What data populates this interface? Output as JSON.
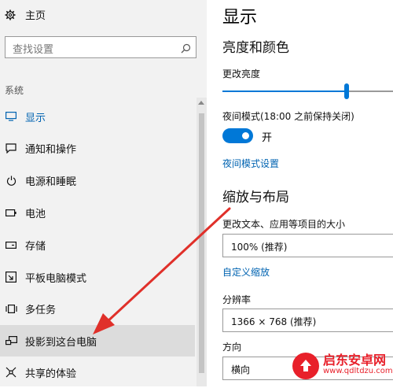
{
  "sidebar": {
    "home_label": "主页",
    "search_placeholder": "查找设置",
    "section_label": "系统",
    "items": [
      {
        "label": "显示",
        "icon": "monitor-icon",
        "active": true
      },
      {
        "label": "通知和操作",
        "icon": "chat-bubble-icon"
      },
      {
        "label": "电源和睡眠",
        "icon": "power-icon"
      },
      {
        "label": "电池",
        "icon": "battery-icon"
      },
      {
        "label": "存储",
        "icon": "storage-icon"
      },
      {
        "label": "平板电脑模式",
        "icon": "tablet-mode-icon"
      },
      {
        "label": "多任务",
        "icon": "multitasking-icon"
      },
      {
        "label": "投影到这台电脑",
        "icon": "project-icon",
        "hover": true
      },
      {
        "label": "共享的体验",
        "icon": "shared-experiences-icon"
      }
    ]
  },
  "main": {
    "title": "显示",
    "brightness_heading": "亮度和颜色",
    "brightness_label": "更改亮度",
    "brightness_value": 0.73,
    "night_mode_label": "夜间模式(18:00 之前保持关闭)",
    "night_mode_state": "开",
    "night_mode_link": "夜间模式设置",
    "scale_heading": "缩放与布局",
    "scale_label": "更改文本、应用等项目的大小",
    "scale_value": "100% (推荐)",
    "custom_scale_link": "自定义缩放",
    "resolution_label": "分辨率",
    "resolution_value": "1366 × 768 (推荐)",
    "orientation_label": "方向",
    "orientation_value": "横向"
  },
  "watermark": {
    "name": "启东安卓网",
    "url": "www.qdltdzu.com"
  },
  "colors": {
    "accent": "#0078d7",
    "link": "#0063b1",
    "arrow": "#e0302a",
    "sidebar_bg": "#f2f2f2"
  }
}
